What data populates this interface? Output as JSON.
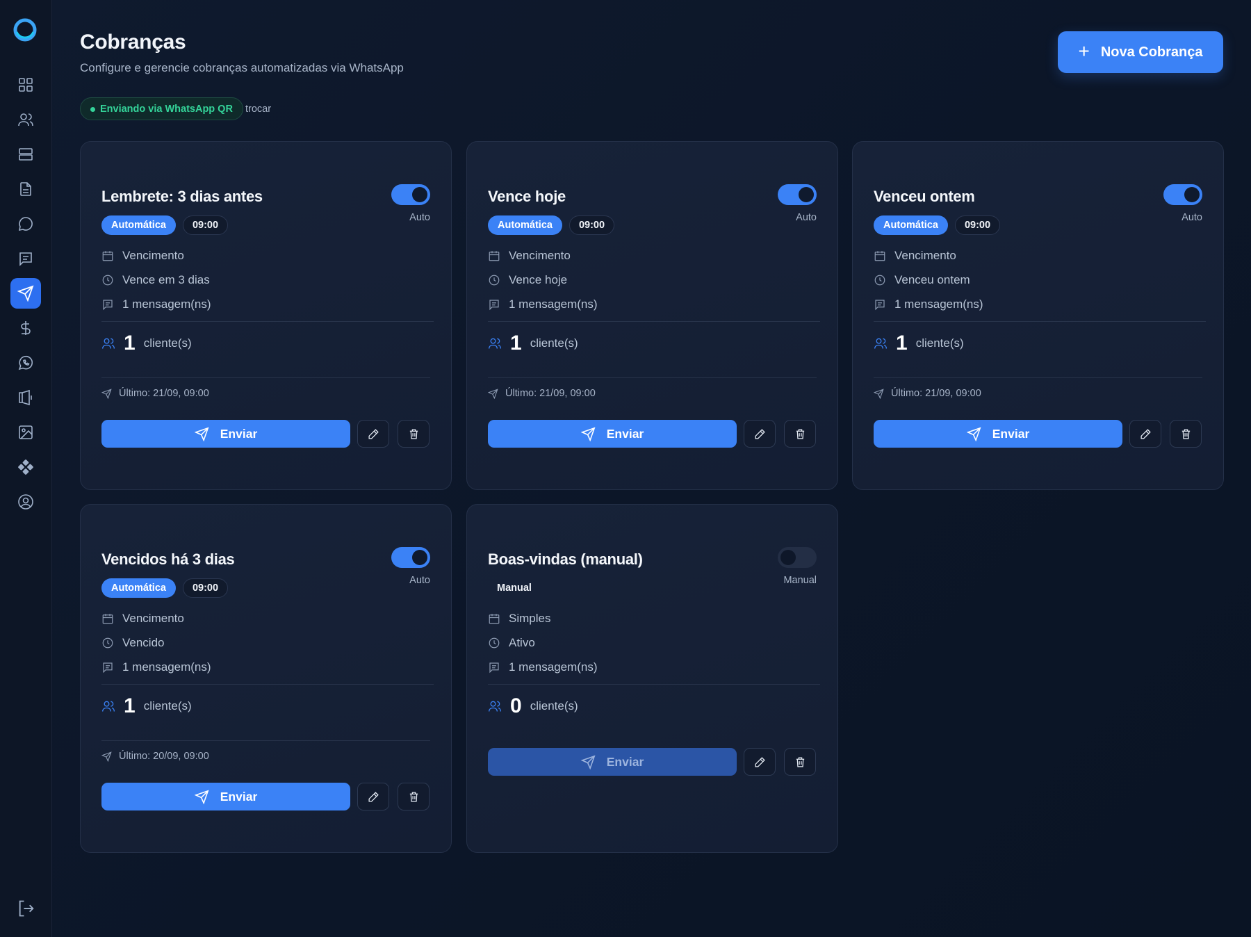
{
  "header": {
    "title": "Cobranças",
    "subtitle": "Configure e gerencie cobranças automatizadas via WhatsApp",
    "new_button_label": "Nova Cobrança"
  },
  "status": {
    "label": "Enviando via WhatsApp QR",
    "switch_label": "trocar",
    "color": "#34d399"
  },
  "sidebar": {
    "items": [
      {
        "icon": "dashboard-grid-icon"
      },
      {
        "icon": "users-icon"
      },
      {
        "icon": "server-icon"
      },
      {
        "icon": "document-icon"
      },
      {
        "icon": "chat-bubble-icon"
      },
      {
        "icon": "message-square-icon"
      },
      {
        "icon": "send-icon",
        "active": true
      },
      {
        "icon": "dollar-icon"
      },
      {
        "icon": "whatsapp-icon"
      },
      {
        "icon": "megaphone-icon"
      },
      {
        "icon": "image-icon"
      },
      {
        "icon": "puzzle-icon"
      },
      {
        "icon": "user-circle-icon"
      }
    ],
    "logout_icon": "logout-icon"
  },
  "cards": [
    {
      "title": "Lembrete: 3 dias antes",
      "enabled": true,
      "toggle_label": "Auto",
      "badge_type": "Automática",
      "time": "09:00",
      "trigger": "Vencimento",
      "schedule": "Vence em 3 dias",
      "messages": "1 mensagem(ns)",
      "clients_count": "1",
      "clients_label": "cliente(s)",
      "last_sent": "Último: 21/09, 09:00",
      "send_label": "Enviar"
    },
    {
      "title": "Vence hoje",
      "enabled": true,
      "toggle_label": "Auto",
      "badge_type": "Automática",
      "time": "09:00",
      "trigger": "Vencimento",
      "schedule": "Vence hoje",
      "messages": "1 mensagem(ns)",
      "clients_count": "1",
      "clients_label": "cliente(s)",
      "last_sent": "Último: 21/09, 09:00",
      "send_label": "Enviar"
    },
    {
      "title": "Venceu ontem",
      "enabled": true,
      "toggle_label": "Auto",
      "badge_type": "Automática",
      "time": "09:00",
      "trigger": "Vencimento",
      "schedule": "Venceu ontem",
      "messages": "1 mensagem(ns)",
      "clients_count": "1",
      "clients_label": "cliente(s)",
      "last_sent": "Último: 21/09, 09:00",
      "send_label": "Enviar"
    },
    {
      "title": "Vencidos há 3 dias",
      "enabled": true,
      "toggle_label": "Auto",
      "badge_type": "Automática",
      "time": "09:00",
      "trigger": "Vencimento",
      "schedule": "Vencido",
      "messages": "1 mensagem(ns)",
      "clients_count": "1",
      "clients_label": "cliente(s)",
      "last_sent": "Último: 20/09, 09:00",
      "send_label": "Enviar"
    },
    {
      "title": "Boas-vindas (manual)",
      "enabled": false,
      "toggle_label": "Manual",
      "badge_type": "Manual",
      "trigger": "Simples",
      "schedule": "Ativo",
      "messages": "1 mensagem(ns)",
      "clients_count": "0",
      "clients_label": "cliente(s)",
      "send_label": "Enviar",
      "send_disabled": true
    }
  ],
  "colors": {
    "accent": "#3b82f6",
    "background": "#0f1a2e",
    "card": "#172238"
  }
}
